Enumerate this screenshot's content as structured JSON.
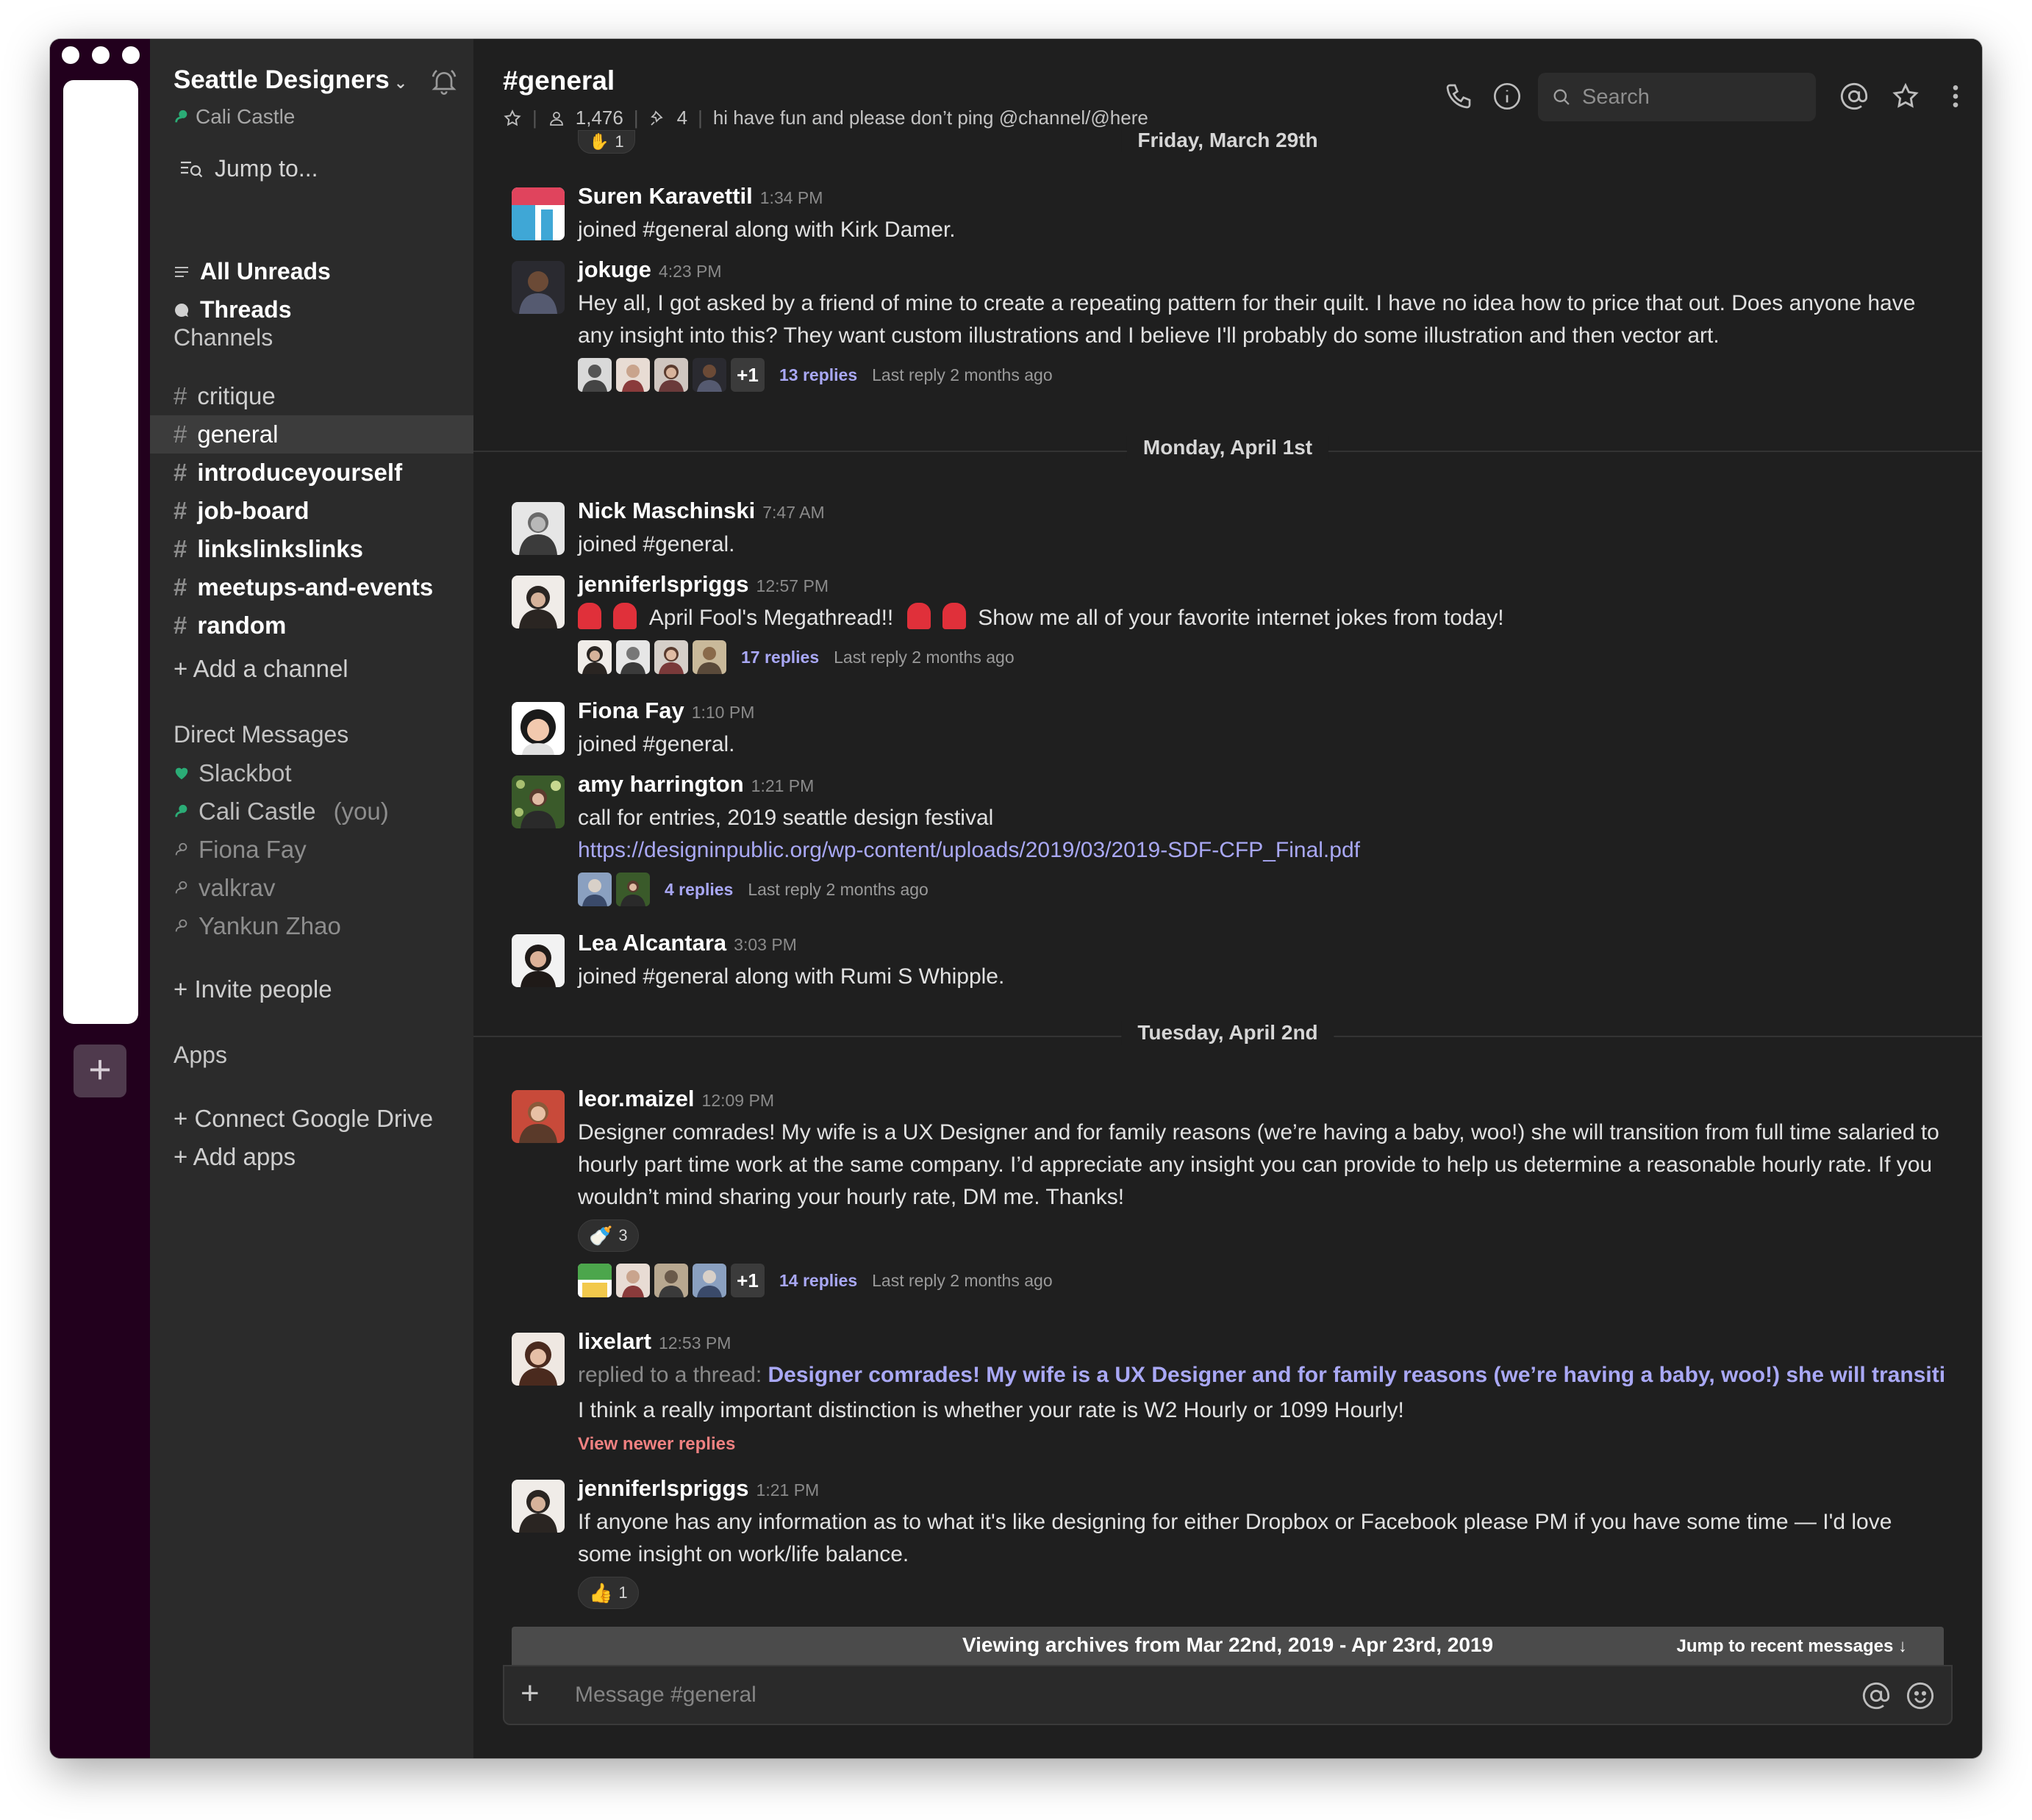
{
  "workspace": {
    "name": "Seattle Designers",
    "user": "Cali Castle",
    "jump_to": "Jump to...",
    "all_unreads": "All Unreads",
    "threads": "Threads"
  },
  "sidebar": {
    "channels_title": "Channels",
    "channels": [
      {
        "name": "critique",
        "state": "normal"
      },
      {
        "name": "general",
        "state": "active"
      },
      {
        "name": "introduceyourself",
        "state": "unread"
      },
      {
        "name": "job-board",
        "state": "unread"
      },
      {
        "name": "linkslinkslinks",
        "state": "unread"
      },
      {
        "name": "meetups-and-events",
        "state": "unread"
      },
      {
        "name": "random",
        "state": "unread"
      }
    ],
    "add_channel": "+ Add a channel",
    "dm_title": "Direct Messages",
    "dms": [
      {
        "name": "Slackbot",
        "status": "bot"
      },
      {
        "name": "Cali Castle",
        "suffix": "(you)",
        "status": "online"
      },
      {
        "name": "Fiona Fay",
        "status": "offline"
      },
      {
        "name": "valkrav",
        "status": "offline"
      },
      {
        "name": "Yankun Zhao",
        "status": "offline"
      }
    ],
    "invite": "+ Invite people",
    "apps_title": "Apps",
    "connect_drive": "+ Connect Google Drive",
    "add_apps": "+ Add apps"
  },
  "header": {
    "channel": "#general",
    "members": "1,476",
    "pinned": "4",
    "topic": "hi have fun and please don’t ping @channel/@here",
    "search_placeholder": "Search"
  },
  "top_reaction_count": "1",
  "days": {
    "d1": "Friday, March 29th",
    "d2": "Monday, April 1st",
    "d3": "Tuesday, April 2nd"
  },
  "messages": [
    {
      "author": "Suren Karavettil",
      "time": "1:34 PM",
      "text": "joined #general along with Kirk Damer."
    },
    {
      "author": "jokuge",
      "time": "4:23 PM",
      "text": "Hey all, I got asked by a friend of mine to create a repeating pattern for their quilt. I have no idea how to price that out. Does anyone have any insight into this? They want custom illustrations and I believe I'll probably do some illustration and then vector art.",
      "plus": "+1",
      "replies": "13 replies",
      "last": "Last reply 2 months ago"
    },
    {
      "author": "Nick Maschinski",
      "time": "7:47 AM",
      "text": "joined #general."
    },
    {
      "author": "jenniferlspriggs",
      "time": "12:57 PM",
      "text_a": "April Fool's Megathread!!",
      "text_b": "Show me all of your favorite internet jokes from today!",
      "replies": "17 replies",
      "last": "Last reply 2 months ago"
    },
    {
      "author": "Fiona Fay",
      "time": "1:10 PM",
      "text": "joined #general."
    },
    {
      "author": "amy harrington",
      "time": "1:21 PM",
      "text": "call for entries, 2019 seattle design festival",
      "link": "https://designinpublic.org/wp-content/uploads/2019/03/2019-SDF-CFP_Final.pdf",
      "replies": "4 replies",
      "last": "Last reply 2 months ago"
    },
    {
      "author": "Lea Alcantara",
      "time": "3:03 PM",
      "text": "joined #general along with Rumi S Whipple."
    },
    {
      "author": "leor.maizel",
      "time": "12:09 PM",
      "text": "Designer comrades! My wife is a UX Designer and for family reasons (we’re having a baby, woo!) she will transition from full time salaried to hourly part time work at the same company. I’d appreciate any insight you can provide to help us determine a reasonable hourly rate. If you wouldn’t mind sharing your hourly rate, DM me. Thanks!",
      "reaction_count": "3",
      "plus": "+1",
      "replies": "14 replies",
      "last": "Last reply 2 months ago"
    },
    {
      "author": "lixelart",
      "time": "12:53 PM",
      "replied_prefix": "replied to a thread:",
      "thread_ref": "Designer comrades! My wife is a UX Designer and for family reasons (we’re having a baby, woo!) she will transition fro...",
      "text": "I think a really important distinction is whether your rate is W2 Hourly or 1099 Hourly!",
      "view_newer": "View newer replies"
    },
    {
      "author": "jenniferlspriggs",
      "time": "1:21 PM",
      "text": "If anyone has any information as to what it's like designing for either Dropbox or Facebook please PM if you have some time — I'd love some insight on work/life balance.",
      "reaction_count": "1"
    }
  ],
  "archive": {
    "text": "Viewing archives from Mar 22nd, 2019 - Apr 23rd, 2019",
    "jump": "Jump to recent messages"
  },
  "composer": {
    "placeholder": "Message #general"
  },
  "colors": {
    "rail": "#22001d",
    "sidebar": "#2b2b2b",
    "main": "#1f1f1f",
    "link": "#a9a8f5",
    "online": "#2bac76",
    "view_newer": "#f08181"
  }
}
